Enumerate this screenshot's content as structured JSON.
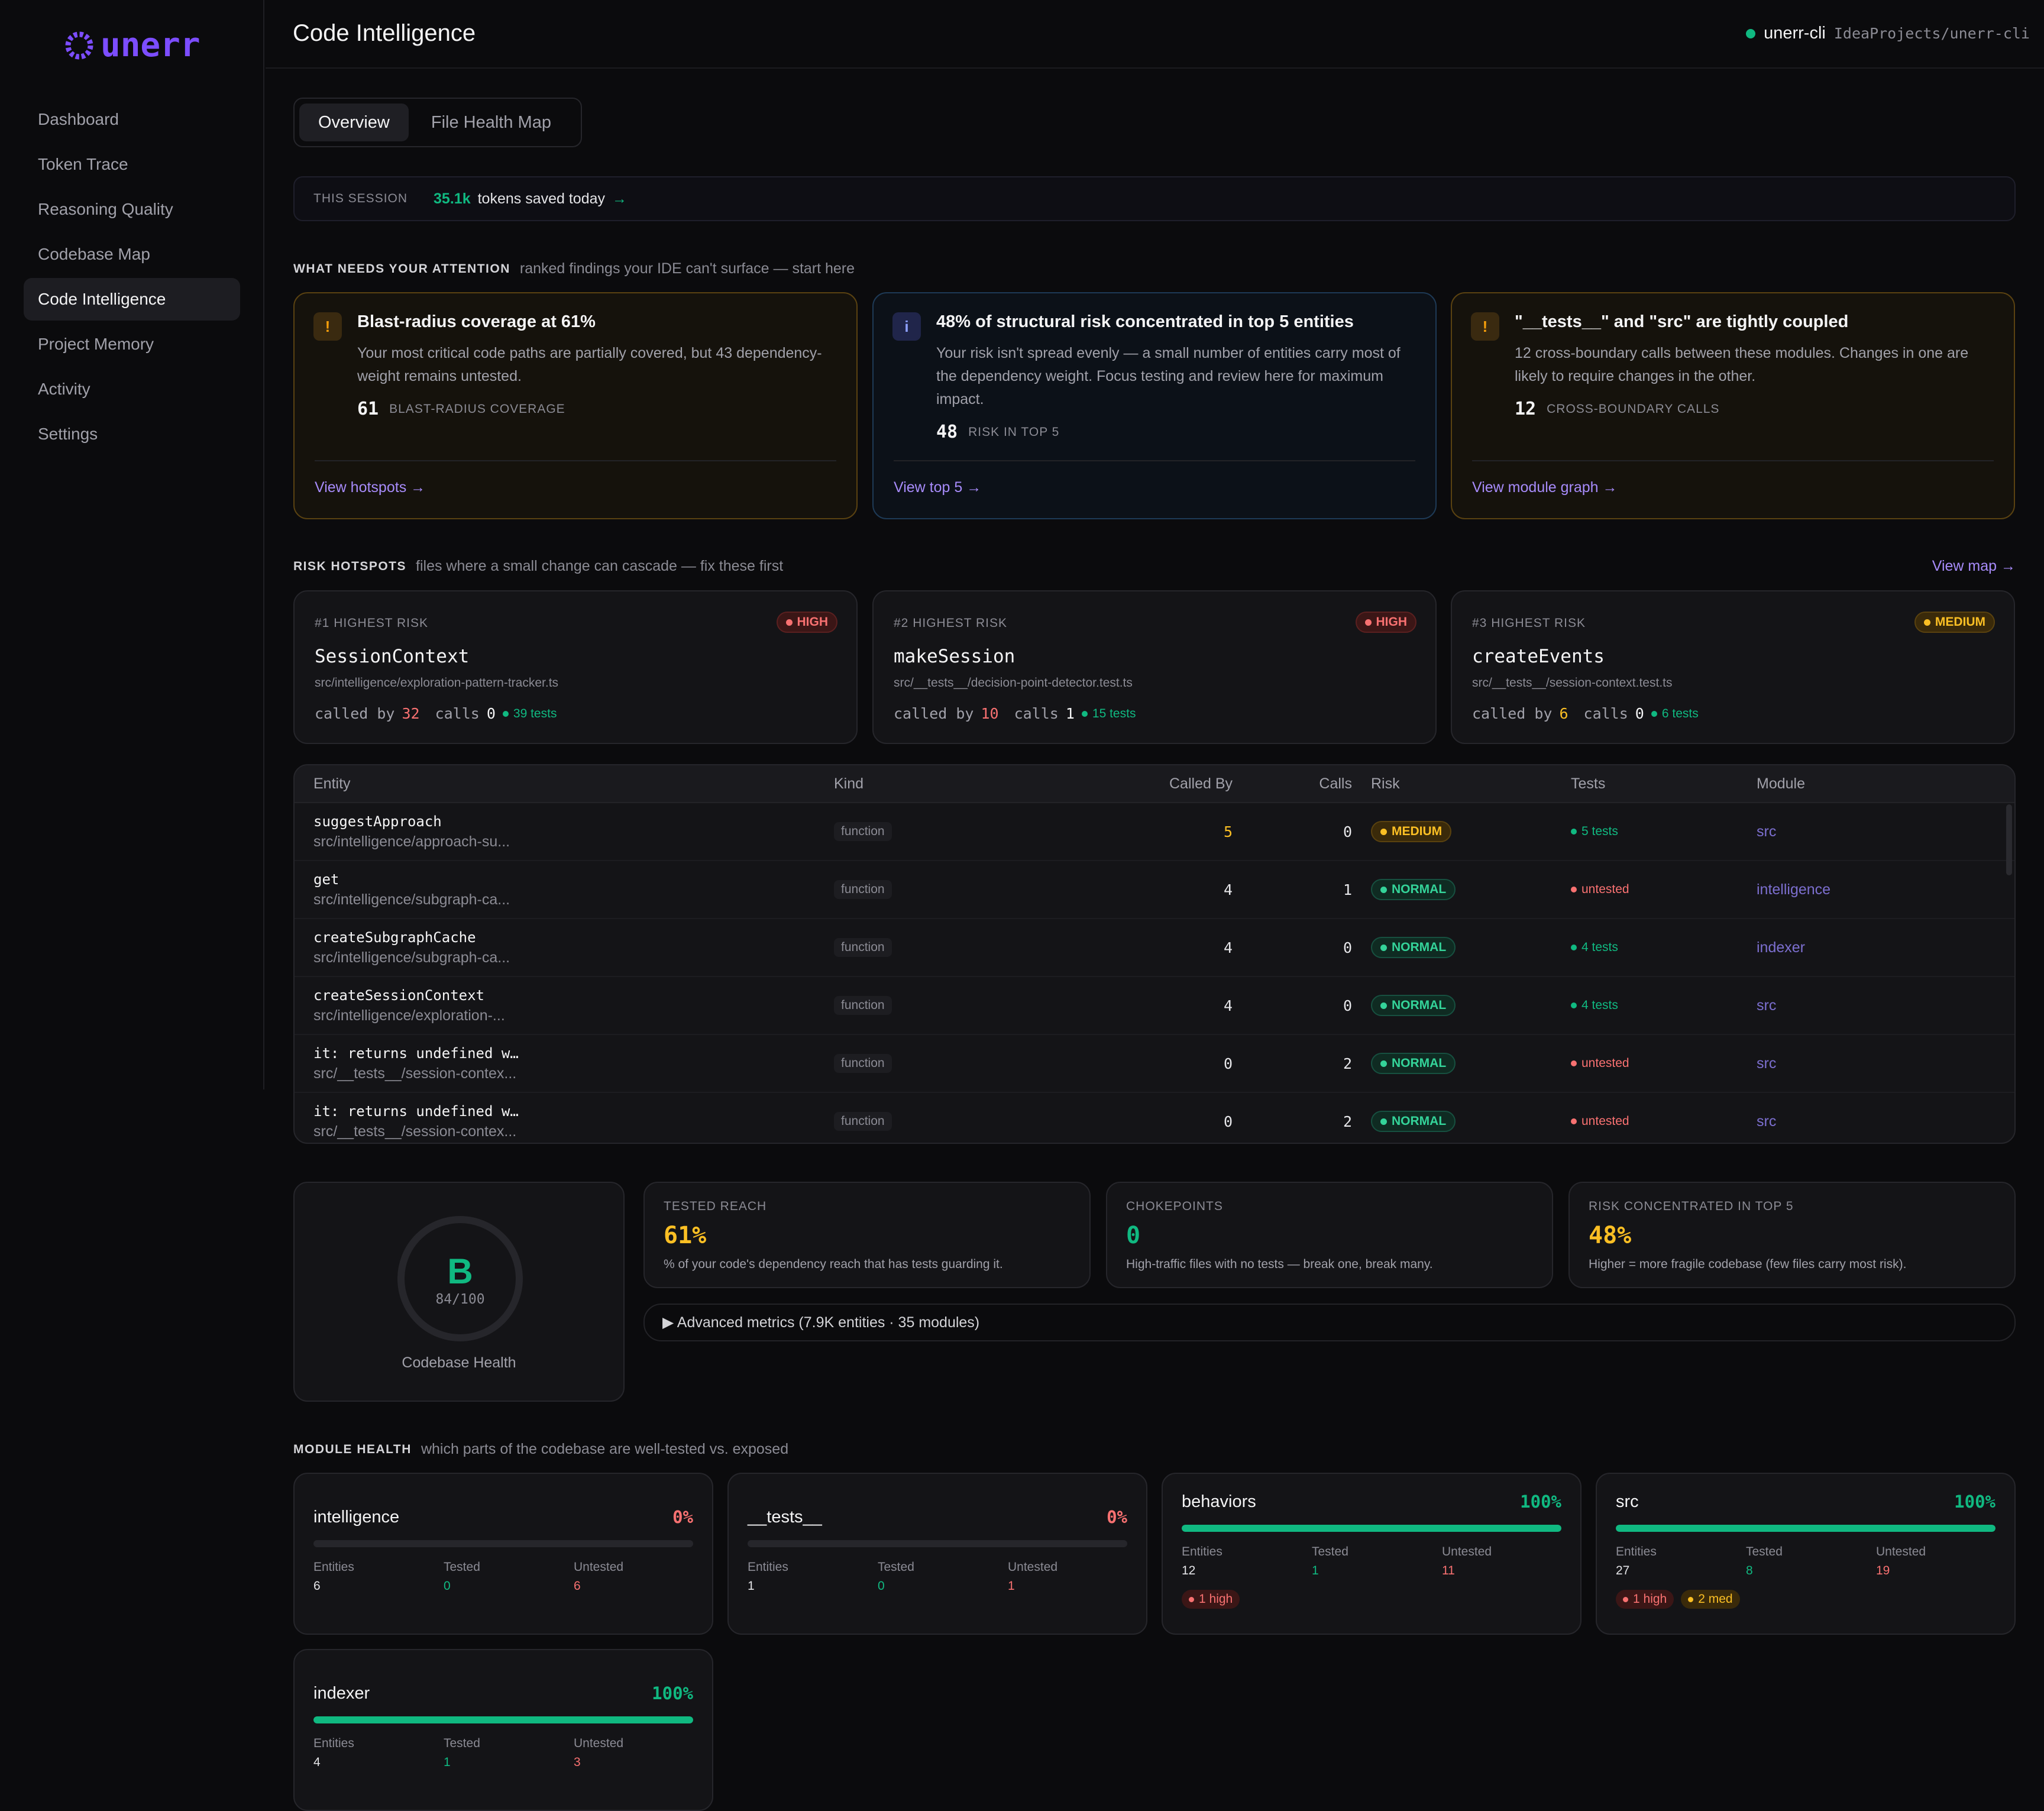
{
  "brand": {
    "name": "unerr"
  },
  "nav": [
    "Dashboard",
    "Token Trace",
    "Reasoning Quality",
    "Codebase Map",
    "Code Intelligence",
    "Project Memory",
    "Activity",
    "Settings"
  ],
  "header": {
    "title": "Code Intelligence",
    "project": "unerr-cli",
    "path": "IdeaProjects/unerr-cli"
  },
  "tabs": [
    "Overview",
    "File Health Map"
  ],
  "session": {
    "label": "THIS SESSION",
    "value": "35.1k",
    "text": "tokens saved today",
    "arrow": "→"
  },
  "attention": {
    "heading": "WHAT NEEDS YOUR ATTENTION",
    "sub": "ranked findings your IDE can't surface — start here",
    "cards": [
      {
        "icon": "!",
        "title": "Blast-radius coverage at 61%",
        "desc": "Your most critical code paths are partially covered, but 43 dependency-weight remains untested.",
        "num": "61",
        "label": "BLAST-RADIUS COVERAGE",
        "link": "View hotspots →"
      },
      {
        "icon": "i",
        "title": "48% of structural risk concentrated in top 5 entities",
        "desc": "Your risk isn't spread evenly — a small number of entities carry most of the dependency weight. Focus testing and review here for maximum impact.",
        "num": "48",
        "label": "RISK IN TOP 5",
        "link": "View top 5 →"
      },
      {
        "icon": "!",
        "title": "\"__tests__\" and \"src\" are tightly coupled",
        "desc": "12 cross-boundary calls between these modules. Changes in one are likely to require changes in the other.",
        "num": "12",
        "label": "CROSS-BOUNDARY CALLS",
        "link": "View module graph →"
      }
    ]
  },
  "hotspots": {
    "heading": "RISK HOTSPOTS",
    "sub": "files where a small change can cascade — fix these first",
    "view": "View map →",
    "cards": [
      {
        "rank": "#1 HIGHEST RISK",
        "badge": "HIGH",
        "name": "SessionContext",
        "path": "src/intelligence/exploration-pattern-tracker.ts",
        "called_by_label": "called by",
        "called_by": "32",
        "calls_label": "calls",
        "calls": "0",
        "tests": "39 tests"
      },
      {
        "rank": "#2 HIGHEST RISK",
        "badge": "HIGH",
        "name": "makeSession",
        "path": "src/__tests__/decision-point-detector.test.ts",
        "called_by_label": "called by",
        "called_by": "10",
        "calls_label": "calls",
        "calls": "1",
        "tests": "15 tests"
      },
      {
        "rank": "#3 HIGHEST RISK",
        "badge": "MEDIUM",
        "name": "createEvents",
        "path": "src/__tests__/session-context.test.ts",
        "called_by_label": "called by",
        "called_by": "6",
        "calls_label": "calls",
        "calls": "0",
        "tests": "6 tests"
      }
    ]
  },
  "table": {
    "headers": [
      "Entity",
      "Kind",
      "Called By",
      "Calls",
      "Risk",
      "Tests",
      "Module"
    ],
    "rows": [
      {
        "name": "suggestApproach",
        "path": "src/intelligence/approach-su...",
        "kind": "function",
        "called_by": "5",
        "calls": "0",
        "risk": "MEDIUM",
        "tests": "5 tests",
        "module": "src"
      },
      {
        "name": "get",
        "path": "src/intelligence/subgraph-ca...",
        "kind": "function",
        "called_by": "4",
        "calls": "1",
        "risk": "NORMAL",
        "tests": "untested",
        "module": "intelligence"
      },
      {
        "name": "createSubgraphCache",
        "path": "src/intelligence/subgraph-ca...",
        "kind": "function",
        "called_by": "4",
        "calls": "0",
        "risk": "NORMAL",
        "tests": "4 tests",
        "module": "indexer"
      },
      {
        "name": "createSessionContext",
        "path": "src/intelligence/exploration-...",
        "kind": "function",
        "called_by": "4",
        "calls": "0",
        "risk": "NORMAL",
        "tests": "4 tests",
        "module": "src"
      },
      {
        "name": "it: returns undefined w…",
        "path": "src/__tests__/session-contex...",
        "kind": "function",
        "called_by": "0",
        "calls": "2",
        "risk": "NORMAL",
        "tests": "untested",
        "module": "src"
      },
      {
        "name": "it: returns undefined w…",
        "path": "src/__tests__/session-contex...",
        "kind": "function",
        "called_by": "0",
        "calls": "2",
        "risk": "NORMAL",
        "tests": "untested",
        "module": "src"
      }
    ]
  },
  "health": {
    "grade": "B",
    "score": "84/100",
    "label": "Codebase Health"
  },
  "metrics": [
    {
      "key": "TESTED REACH",
      "value": "61%",
      "desc": "% of your code's dependency reach that has tests guarding it.",
      "color": "#fbbf24"
    },
    {
      "key": "CHOKEPOINTS",
      "value": "0",
      "desc": "High-traffic files with no tests — break one, break many.",
      "color": "#10b981"
    },
    {
      "key": "RISK CONCENTRATED IN TOP 5",
      "value": "48%",
      "desc": "Higher = more fragile codebase (few files carry most risk).",
      "color": "#fbbf24"
    }
  ],
  "advanced": "▶ Advanced metrics (7.9K entities · 35 modules)",
  "modules": {
    "heading": "MODULE HEALTH",
    "sub": "which parts of the codebase are well-tested vs. exposed",
    "col_labels": [
      "Entities",
      "Tested",
      "Untested"
    ],
    "items": [
      {
        "name": "intelligence",
        "pct": "0%",
        "fill": 0,
        "entities": "6",
        "tested": "0",
        "untested": "6",
        "chips": []
      },
      {
        "name": "__tests__",
        "pct": "0%",
        "fill": 0,
        "entities": "1",
        "tested": "0",
        "untested": "1",
        "chips": []
      },
      {
        "name": "behaviors",
        "pct": "100%",
        "fill": 1,
        "entities": "12",
        "tested": "1",
        "untested": "11",
        "chips": [
          "1 high"
        ]
      },
      {
        "name": "src",
        "pct": "100%",
        "fill": 1,
        "entities": "27",
        "tested": "8",
        "untested": "19",
        "chips": [
          "1 high",
          "2 med"
        ]
      },
      {
        "name": "indexer",
        "pct": "100%",
        "fill": 1,
        "entities": "4",
        "tested": "1",
        "untested": "3",
        "chips": []
      }
    ]
  }
}
